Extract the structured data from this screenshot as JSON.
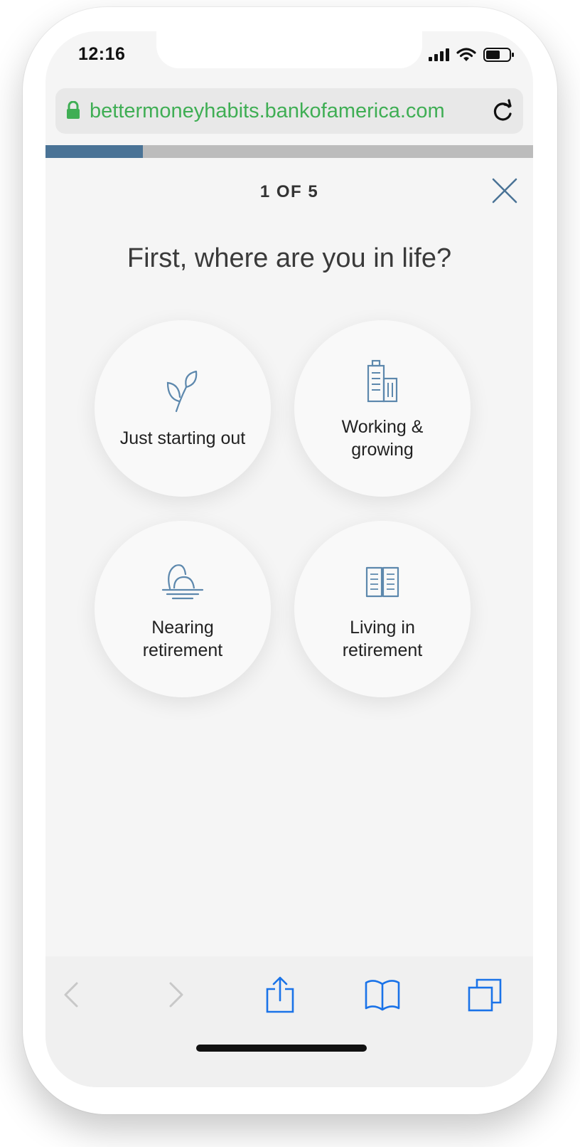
{
  "status_bar": {
    "time": "12:16"
  },
  "browser": {
    "url": "bettermoneyhabits.bankofamerica.com"
  },
  "progress": {
    "value": 0.2
  },
  "quiz": {
    "step": "1 OF 5",
    "question": "First, where are you in life?",
    "options": [
      {
        "label": "Just starting out",
        "icon": "sprout-icon"
      },
      {
        "label": "Working & growing",
        "icon": "building-icon"
      },
      {
        "label": "Nearing retirement",
        "icon": "sunset-icon"
      },
      {
        "label": "Living in retirement",
        "icon": "book-icon"
      }
    ]
  },
  "colors": {
    "accent": "#4a7396",
    "url_green": "#3fae54",
    "ios_blue": "#1a73e8",
    "icon_blue": "#5d88ad"
  }
}
